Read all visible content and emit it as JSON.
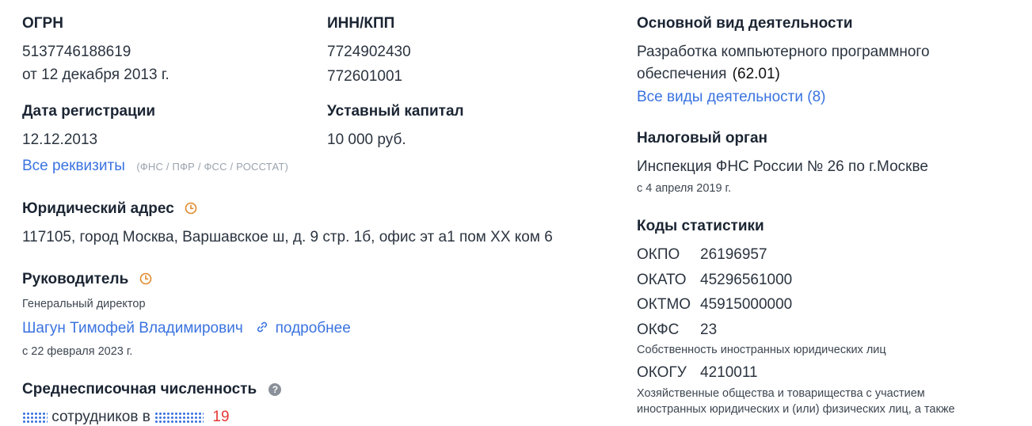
{
  "ogrn": {
    "label": "ОГРН",
    "value": "5137746188619",
    "date": "от 12 декабря 2013 г."
  },
  "inn_kpp": {
    "label": "ИНН/КПП",
    "inn": "7724902430",
    "kpp": "772601001"
  },
  "registration": {
    "label": "Дата регистрации",
    "value": "12.12.2013"
  },
  "capital": {
    "label": "Уставный капитал",
    "value": "10 000 руб."
  },
  "requisites": {
    "link": "Все реквизиты",
    "note": "(ФНС / ПФР / ФСС / РОССТАТ)"
  },
  "address": {
    "label": "Юридический адрес",
    "value": "117105, город Москва, Варшавское ш, д. 9 стр. 1б, офис эт а1 пом XX ком 6"
  },
  "director": {
    "label": "Руководитель",
    "position": "Генеральный директор",
    "name": "Шагун Тимофей Владимирович",
    "more": "подробнее",
    "since": "с 22 февраля 2023 г."
  },
  "employees": {
    "label": "Среднесписочная численность",
    "text": "сотрудников в",
    "trailing": "19"
  },
  "activity": {
    "label": "Основной вид деятельности",
    "line1": "Разработка компьютерного программного",
    "line2": "обеспечения",
    "code": "(62.01)",
    "all_link": "Все виды деятельности (8)"
  },
  "tax": {
    "label": "Налоговый орган",
    "value": "Инспекция ФНС России № 26 по г.Москве",
    "since": "с 4 апреля 2019 г."
  },
  "stats": {
    "label": "Коды статистики",
    "okpo": {
      "code": "ОКПО",
      "value": "26196957"
    },
    "okato": {
      "code": "ОКАТО",
      "value": "45296561000"
    },
    "oktmo": {
      "code": "ОКТМО",
      "value": "45915000000"
    },
    "okfs": {
      "code": "ОКФС",
      "value": "23",
      "desc": "Собственность иностранных юридических лиц"
    },
    "okogu": {
      "code": "ОКОГУ",
      "value": "4210011",
      "desc1": "Хозяйственные общества и товарищества с участием",
      "desc2": "иностранных юридических и (или) физических лиц, а также"
    }
  }
}
